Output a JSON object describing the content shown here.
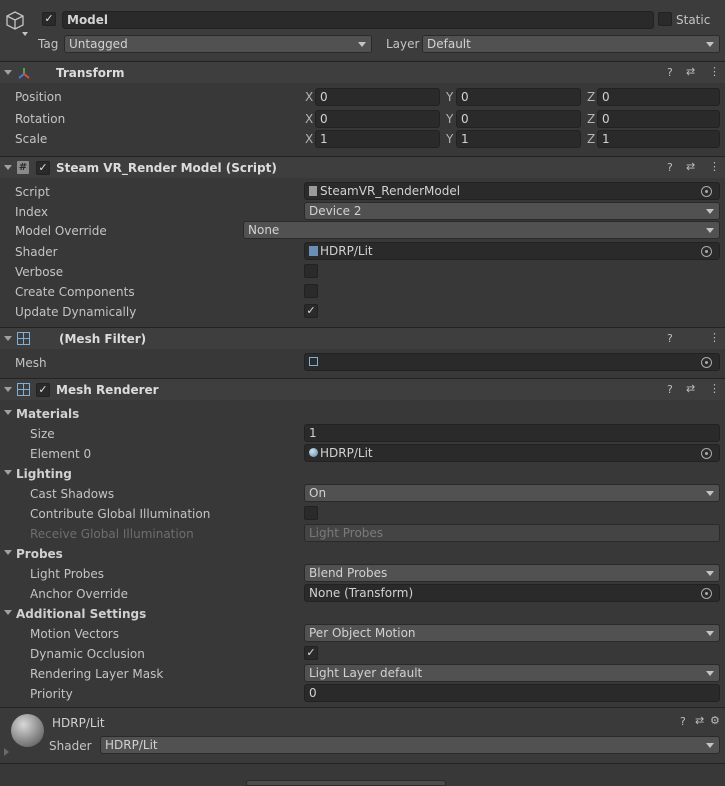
{
  "object": {
    "name": "Model",
    "static_label": "Static",
    "tag_label": "Tag",
    "tag_value": "Untagged",
    "layer_label": "Layer",
    "layer_value": "Default"
  },
  "transform": {
    "title": "Transform",
    "rows": [
      {
        "label": "Position",
        "x": "0",
        "y": "0",
        "z": "0"
      },
      {
        "label": "Rotation",
        "x": "0",
        "y": "0",
        "z": "0"
      },
      {
        "label": "Scale",
        "x": "1",
        "y": "1",
        "z": "1"
      }
    ],
    "axis": {
      "x": "X",
      "y": "Y",
      "z": "Z"
    }
  },
  "steamvr": {
    "title": "Steam VR_Render Model (Script)",
    "script_label": "Script",
    "script_value": "SteamVR_RenderModel",
    "index_label": "Index",
    "index_value": "Device 2",
    "override_label": "Model Override",
    "override_value": "None",
    "shader_label": "Shader",
    "shader_value": "HDRP/Lit",
    "verbose_label": "Verbose",
    "create_label": "Create Components",
    "update_label": "Update Dynamically"
  },
  "meshfilter": {
    "title": "(Mesh Filter)",
    "mesh_label": "Mesh"
  },
  "renderer": {
    "title": "Mesh Renderer",
    "materials": "Materials",
    "size_label": "Size",
    "size_value": "1",
    "element_label": "Element 0",
    "element_value": "HDRP/Lit",
    "lighting": "Lighting",
    "cast_label": "Cast Shadows",
    "cast_value": "On",
    "contrib_label": "Contribute Global Illumination",
    "receive_label": "Receive Global Illumination",
    "receive_value": "Light Probes",
    "probes": "Probes",
    "lightprobes_label": "Light Probes",
    "lightprobes_value": "Blend Probes",
    "anchor_label": "Anchor Override",
    "anchor_value": "None (Transform)",
    "additional": "Additional Settings",
    "motion_label": "Motion Vectors",
    "motion_value": "Per Object Motion",
    "dynocc_label": "Dynamic Occlusion",
    "layer_label": "Rendering Layer Mask",
    "layer_value": "Light Layer default",
    "priority_label": "Priority",
    "priority_value": "0"
  },
  "material": {
    "name": "HDRP/Lit",
    "shader_label": "Shader",
    "shader_value": "HDRP/Lit"
  },
  "checkmark": "✓",
  "icons": {
    "help": "help-icon",
    "presets": "presets-icon",
    "menu": "kebab-menu-icon",
    "settings": "gear-icon"
  }
}
